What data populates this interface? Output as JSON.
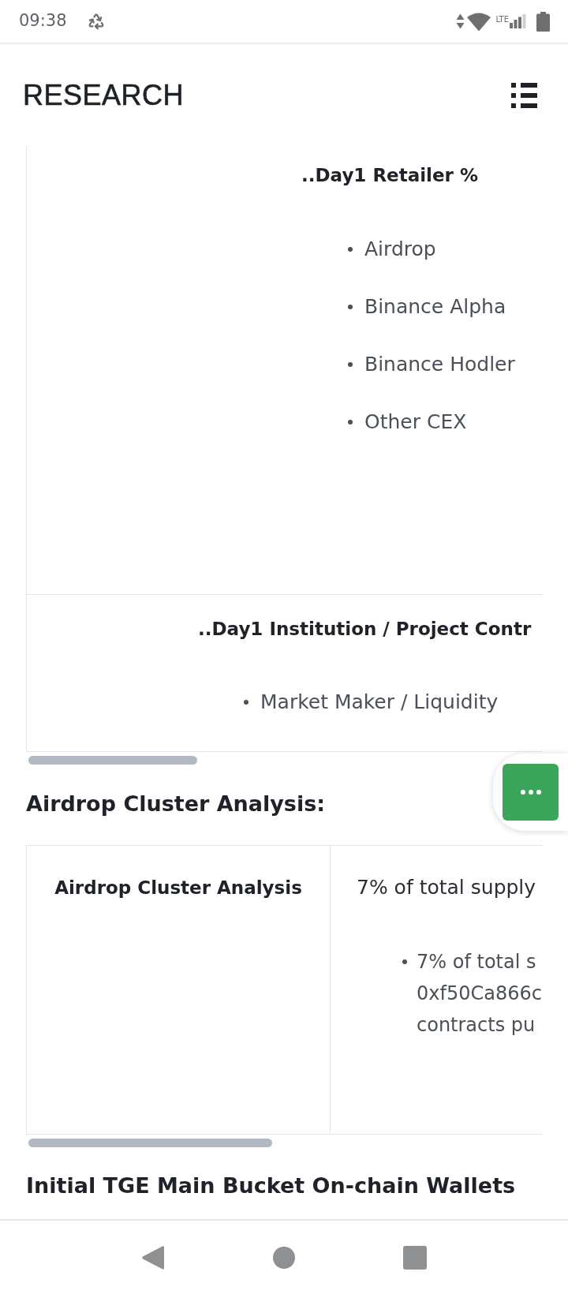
{
  "status_bar": {
    "time": "09:38",
    "network_type": "LTE"
  },
  "header": {
    "title": "RESEARCH"
  },
  "content": [
    {
      "kind": "stacked_table",
      "rows": [
        {
          "heading": "..Day1 Retailer %",
          "items": [
            "Airdrop",
            "Binance Alpha",
            "Binance Hodler",
            "Other CEX"
          ]
        },
        {
          "heading": "..Day1 Institution / Project Contr",
          "items": [
            "Market Maker / Liquidity"
          ]
        }
      ]
    },
    {
      "kind": "heading",
      "text": "Airdrop Cluster Analysis:"
    },
    {
      "kind": "grid_table",
      "cells": [
        {
          "kind": "label",
          "text": "Airdrop Cluster Analysis"
        },
        {
          "kind": "value",
          "text": "7% of total supply",
          "items": [
            {
              "lines": [
                "7% of total s",
                "0xf50Ca866c",
                "contracts pu"
              ]
            }
          ]
        }
      ]
    },
    {
      "kind": "heading",
      "text": "Initial TGE Main Bucket On-chain Wallets"
    }
  ]
}
